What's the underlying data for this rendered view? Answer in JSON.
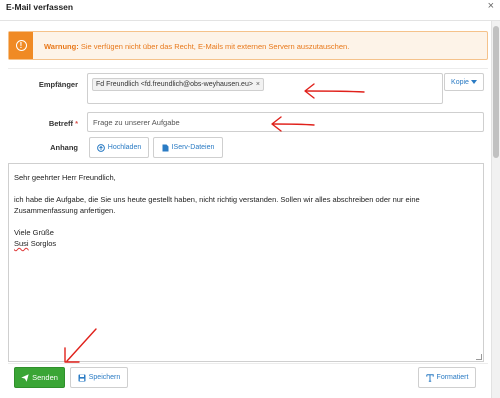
{
  "dialog": {
    "title": "E-Mail verfassen",
    "close_glyph": "×"
  },
  "warning": {
    "icon": "exclamation-icon",
    "prefix": "Warnung:",
    "message": "Sie verfügen nicht über das Recht, E-Mails mit externen Servern auszutauschen."
  },
  "form": {
    "recipient_label": "Empfänger",
    "recipient_chip": "Fd Freundlich <fd.freundlich@obs-weyhausen.eu>",
    "recipient_chip_remove": "×",
    "copy_label": "Kopie",
    "subject_label": "Betreff",
    "subject_required_mark": "*",
    "subject_value": "Frage zu unserer Aufgabe",
    "attachment_label": "Anhang",
    "upload_label": "Hochladen",
    "iserv_files_label": "IServ-Dateien"
  },
  "body": {
    "greeting": "Sehr geehrter Herr Freundlich,",
    "paragraph": "ich habe die Aufgabe, die Sie uns heute gestellt haben, nicht richtig verstanden. Sollen wir alles abschreiben oder nur eine Zusammenfassung anfertigen.",
    "closing": "Viele Grüße",
    "signature_first": "Susi",
    "signature_last": "Sorglos"
  },
  "footer": {
    "send_label": "Senden",
    "save_label": "Speichern",
    "formatted_label": "Formatiert"
  },
  "colors": {
    "accent": "#2a7bc4",
    "warning": "#f08a24",
    "send": "#3aa535",
    "annotation": "#e0211b"
  }
}
